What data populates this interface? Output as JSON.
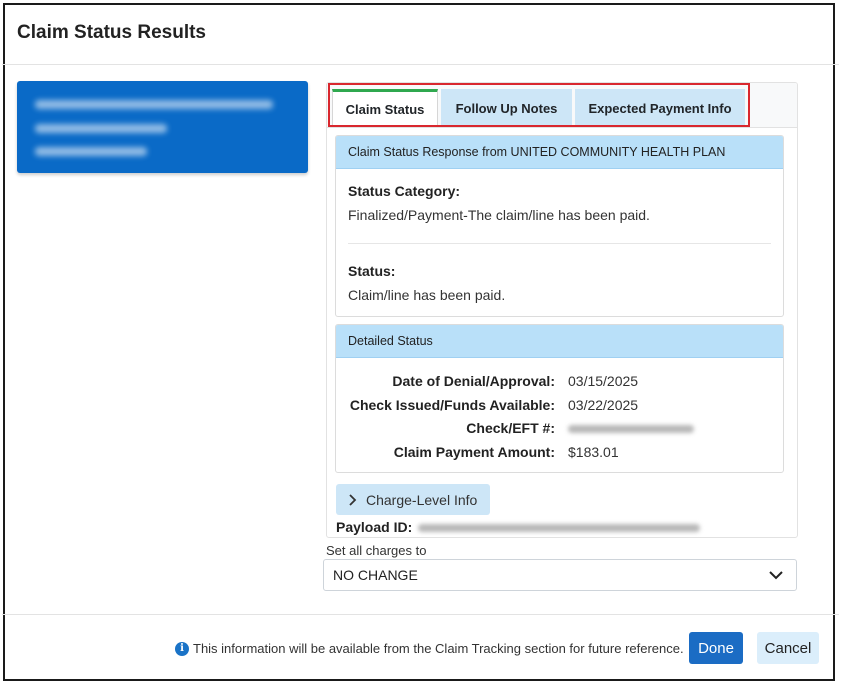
{
  "dialog": {
    "title": "Claim Status Results"
  },
  "tabs": [
    {
      "label": "Claim Status",
      "active": true
    },
    {
      "label": "Follow Up Notes",
      "active": false
    },
    {
      "label": "Expected Payment Info",
      "active": false
    }
  ],
  "response": {
    "header": "Claim Status Response from UNITED COMMUNITY HEALTH PLAN",
    "category_label": "Status Category:",
    "category_value": "Finalized/Payment-The claim/line has been paid.",
    "status_label": "Status:",
    "status_value": "Claim/line has been paid."
  },
  "detailed": {
    "header": "Detailed Status",
    "rows": [
      {
        "label": "Date of Denial/Approval:",
        "value": "03/15/2025"
      },
      {
        "label": "Check Issued/Funds Available:",
        "value": "03/22/2025"
      },
      {
        "label": "Check/EFT #:",
        "value": ""
      },
      {
        "label": "Claim Payment Amount:",
        "value": "$183.01"
      }
    ]
  },
  "charge_level": {
    "label": "Charge-Level Info"
  },
  "payload": {
    "label": "Payload ID:"
  },
  "set_charges": {
    "label": "Set all charges to",
    "selected": "NO CHANGE"
  },
  "footer": {
    "info_text": "This information will be available from the Claim Tracking section for future reference.",
    "done_label": "Done",
    "cancel_label": "Cancel"
  },
  "colors": {
    "accent": "#1b6cc4",
    "card_blue": "#0a6ac7",
    "header_blue": "#b9e0f9",
    "tab_active_border": "#2fa84f",
    "highlight_red": "#d9272e"
  }
}
